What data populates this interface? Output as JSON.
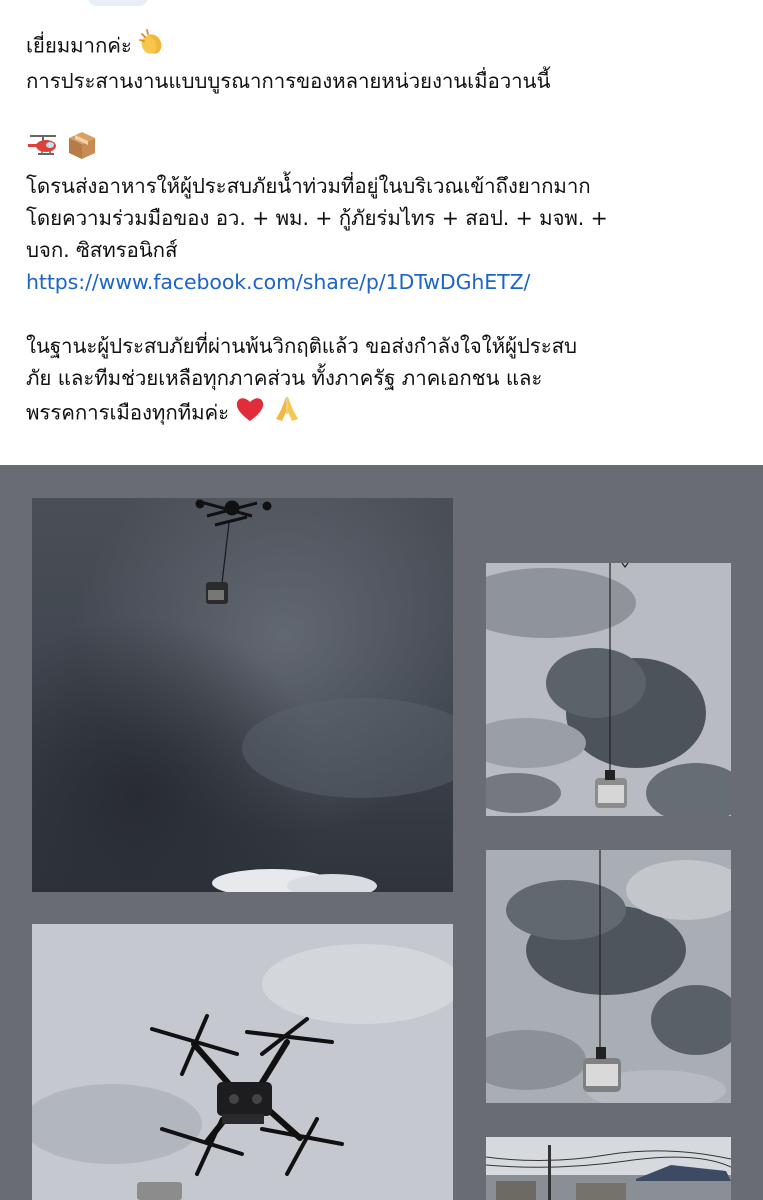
{
  "post": {
    "line1": "เยี่ยมมากค่ะ",
    "line2": "การประสานงานแบบบูรณาการของหลายหน่วยงานเมื่อวานนี้",
    "line4": "โดรนส่งอาหารให้ผู้ประสบภัยน้ำท่วมที่อยู่ในบริเวณเข้าถึงยากมาก",
    "line5": "โดยความร่วมมือของ อว. + พม. + กู้ภัยร่มไทร + สอป. + มจพ. +",
    "line6": "บจก. ซิสทรอนิกส์",
    "link": "https://www.facebook.com/share/p/1DTwDGhETZ/",
    "line8": "ในฐานะผู้ประสบภัยที่ผ่านพ้นวิกฤติแล้ว ขอส่งกำลังใจให้ผู้ประสบ",
    "line9": "ภัย และทีมช่วยเหลือทุกภาคส่วน ทั้งภาครัฐ ภาคเอกชน และ",
    "line10": "พรรคการเมืองทุกทีมค่ะ",
    "emoji": {
      "clap": "clapping-hands",
      "helicopter": "helicopter",
      "package": "package",
      "heart": "red-heart",
      "pray": "folded-hands"
    }
  },
  "colors": {
    "link": "#1d64c8",
    "grid_background": "#696c73"
  },
  "photos": [
    {
      "name": "drone-with-package-cloudy-sky"
    },
    {
      "name": "package-on-line-sky-1"
    },
    {
      "name": "package-on-line-sky-2"
    },
    {
      "name": "drone-closeup-hexacopter"
    },
    {
      "name": "rooftops-thumbnail"
    }
  ]
}
